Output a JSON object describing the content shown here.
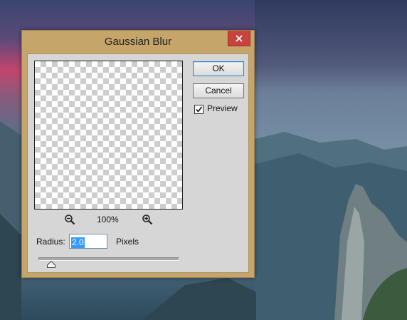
{
  "dialog": {
    "title": "Gaussian Blur",
    "ok_label": "OK",
    "cancel_label": "Cancel",
    "preview_label": "Preview",
    "preview_checked": true,
    "zoom_level": "100%",
    "radius_label": "Radius:",
    "radius_value": "2.0",
    "radius_unit": "Pixels",
    "slider_fraction": 0.09
  },
  "colors": {
    "title_bar": "#c6a56b",
    "close_button": "#c7433e",
    "dialog_body": "#d6d6d6",
    "selection": "#3399ff"
  },
  "icons": [
    "close-icon",
    "zoom-out-icon",
    "zoom-in-icon",
    "check-icon",
    "slider-thumb-icon"
  ]
}
